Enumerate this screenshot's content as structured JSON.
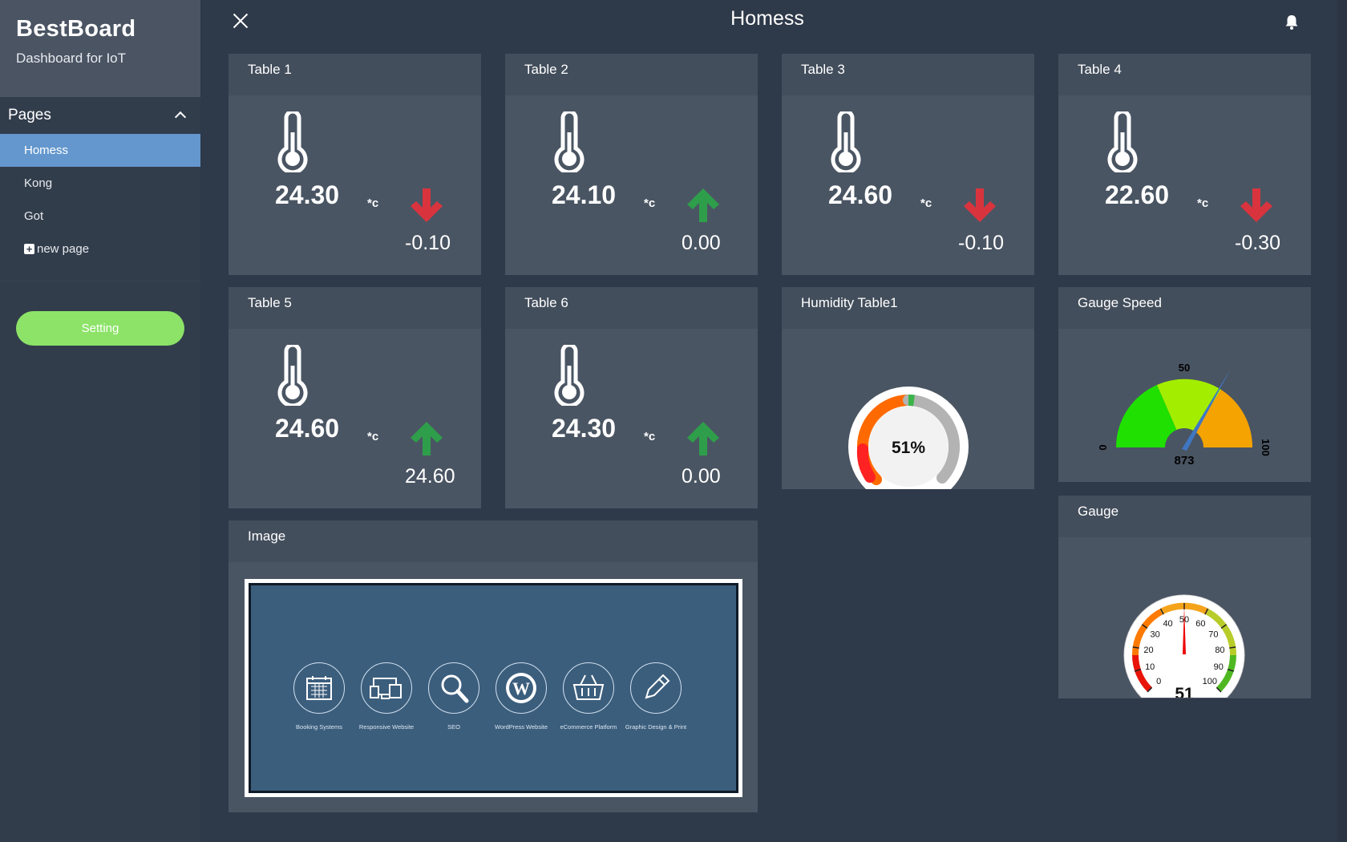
{
  "sidebar": {
    "brand_title": "BestBoard",
    "brand_subtitle": "Dashboard for IoT",
    "pages_label": "Pages",
    "items": [
      {
        "label": "Homess",
        "active": true
      },
      {
        "label": "Kong",
        "active": false
      },
      {
        "label": "Got",
        "active": false
      }
    ],
    "new_page_label": "new page",
    "setting_label": "Setting"
  },
  "topbar": {
    "title": "Homess",
    "close_icon": "close-icon",
    "bell_icon": "bell-icon"
  },
  "colors": {
    "accent": "#6497cd",
    "setting": "#8ce368",
    "up": "#2e9e4a",
    "down": "#d9343e"
  },
  "tables": [
    {
      "title": "Table 1",
      "value": "24.30",
      "unit": "*c",
      "trend": "down",
      "delta": "-0.10"
    },
    {
      "title": "Table 2",
      "value": "24.10",
      "unit": "*c",
      "trend": "up",
      "delta": "0.00"
    },
    {
      "title": "Table 3",
      "value": "24.60",
      "unit": "*c",
      "trend": "down",
      "delta": "-0.10"
    },
    {
      "title": "Table 4",
      "value": "22.60",
      "unit": "*c",
      "trend": "down",
      "delta": "-0.30"
    },
    {
      "title": "Table 5",
      "value": "24.60",
      "unit": "*c",
      "trend": "up",
      "delta": "24.60"
    },
    {
      "title": "Table 6",
      "value": "24.30",
      "unit": "*c",
      "trend": "up",
      "delta": "0.00"
    }
  ],
  "humidity": {
    "title": "Humidity Table1",
    "value_label": "51%",
    "value": 51
  },
  "gauge_speed": {
    "title": "Gauge Speed",
    "min_label": "0",
    "mid_label": "50",
    "max_label": "100",
    "value_label": "873"
  },
  "gauge": {
    "title": "Gauge",
    "value_label": "51",
    "value": 51,
    "ticks": [
      "0",
      "10",
      "20",
      "30",
      "40",
      "50",
      "60",
      "70",
      "80",
      "90",
      "100"
    ]
  },
  "image_widget": {
    "title": "Image",
    "services": [
      {
        "label": "Booking Systems",
        "icon": "calendar-icon"
      },
      {
        "label": "Responsive Website",
        "icon": "devices-icon"
      },
      {
        "label": "SEO",
        "icon": "magnifier-icon"
      },
      {
        "label": "WordPress Website",
        "icon": "wordpress-icon"
      },
      {
        "label": "eCommerce Platform",
        "icon": "basket-icon"
      },
      {
        "label": "Graphic Design & Print",
        "icon": "pencil-icon"
      }
    ]
  }
}
